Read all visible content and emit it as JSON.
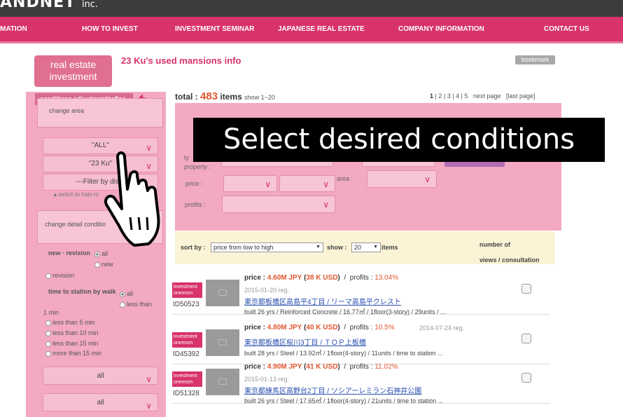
{
  "brand": {
    "logo_text": "ANDNET",
    "logo_suffix": "inc."
  },
  "nav": {
    "items": [
      "MATION",
      "HOW TO INVEST",
      "INVESTMENT SEMINAR",
      "JAPANESE REAL ESTATE",
      "COMPANY INFORMATION",
      "CONTACT US"
    ]
  },
  "header": {
    "re_button": "real estate investment",
    "title": "23 Ku's used mansions info",
    "bookmark": "bookmark"
  },
  "sidebar": {
    "tab": "conditions adjustment/refine",
    "change_area": "change area",
    "select_all": "\"ALL\"",
    "select_ku": "\"23 Ku\"",
    "filter_district": "---Filter by distri",
    "train_link": "▲switch to train ro",
    "change_detail": "change detail conditio",
    "new_revision": "new · revision",
    "opt_all": "all",
    "opt_new": "new",
    "opt_revision": "revision",
    "time_station": "time to station by walk",
    "opt_less_than": "less than",
    "one_min": "1 min",
    "lt5": "less than 5 min",
    "lt10": "less than 10 min",
    "lt15": "less than 15 min",
    "mt15": "more than 15 min",
    "select_all2": "all",
    "select_all3": "all"
  },
  "results": {
    "total_label": "total :",
    "total_count": "483",
    "items_label": "items",
    "show_range": "show 1~20",
    "pager": {
      "current": "1",
      "pages": " | 2 | 3 | 4 | 5",
      "next": "next page",
      "last": "[last page]"
    }
  },
  "conditions": {
    "type_label": "ty",
    "property_label": "property :",
    "price_label": "price :",
    "area_label": "area :",
    "profits_label": "profits :"
  },
  "overlay": {
    "caption": "Select desired conditions"
  },
  "sortbar": {
    "sort_label": "sort by :",
    "sort_value": "price from low to high",
    "show_label": "show :",
    "show_value": "20",
    "items_label": "items",
    "views_label_1": "number of",
    "views_label_2": "views / consultation"
  },
  "listings": [
    {
      "badge": "investment onemom",
      "id": "ID50523",
      "price_label": "price :",
      "price_jpy": "4.60M JPY",
      "price_usd": "38 K USD",
      "profits_label": "profits :",
      "profits": "13.04%",
      "date": "2015-01-20 reg.",
      "title": "東京都板橋区高島平4丁目 / リーマ高島平クレスト",
      "spec": "built 26 yrs / Reinforced Concrete / 16.77㎡ / 1floor(3-story) / 29units / ..."
    },
    {
      "badge": "investment onemom",
      "id": "ID45392",
      "price_label": "price :",
      "price_jpy": "4.80M JPY",
      "price_usd": "40 K USD",
      "profits_label": "profits :",
      "profits": "10.5%",
      "date": "2014-07-24 reg.",
      "title": "東京都板橋区桜川3丁目 / ＴＯＰ上板橋",
      "spec": "built 28 yrs / Steel / 13.92㎡ / 1floor(4-story) / 11units / time to station ..."
    },
    {
      "badge": "investment onemom",
      "id": "ID51328",
      "price_label": "price :",
      "price_jpy": "4.90M JPY",
      "price_usd": "41 K USD",
      "profits_label": "profits :",
      "profits": "11.02%",
      "date": "2015-01-13 reg.",
      "title": "東京都練馬区高野台2丁目 / ソシアーレミラン石神井公園",
      "spec": "built 26 yrs / Steel / 17.65㎡ / 1floor(4-story) / 21units / time to station ..."
    }
  ],
  "colors": {
    "accent": "#d8336b",
    "panel": "#f2a9c1",
    "highlight": "#e0562f"
  },
  "icons": {
    "back": "curved-arrow-left-icon",
    "pointer": "hand-pointer-icon"
  }
}
